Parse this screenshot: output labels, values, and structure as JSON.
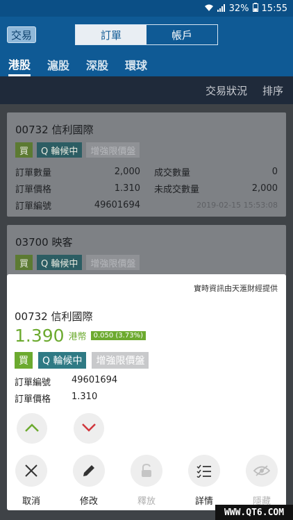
{
  "status": {
    "signal": "⋮☰",
    "battery": "32%",
    "time": "15:55"
  },
  "header": {
    "trade_label": "交易",
    "segments": [
      "訂單",
      "帳戶"
    ],
    "market_tabs": [
      "港股",
      "滬股",
      "深股",
      "環球"
    ]
  },
  "subbar": {
    "status_label": "交易狀況",
    "sort_label": "排序"
  },
  "orders": [
    {
      "title": "00732  信利國際",
      "badges": [
        "買",
        "Q 輪候中",
        "增強限價盤"
      ],
      "qty_label": "訂單數量",
      "qty": "2,000",
      "filled_label": "成交數量",
      "filled": "0",
      "price_label": "訂單價格",
      "price": "1.310",
      "unfilled_label": "未成交數量",
      "unfilled": "2,000",
      "no_label": "訂單編號",
      "no": "49601694",
      "time": "2019-02-15 15:53:08"
    },
    {
      "title": "03700  映客",
      "badges": [
        "買",
        "Q 輪候中",
        "增強限價盤"
      ]
    }
  ],
  "sheet": {
    "provider": "實時資訊由天滙財經提供",
    "title": "00732  信利國際",
    "price": "1.390",
    "currency": "港幣",
    "change": "0.050 (3.73%)",
    "badges": [
      "買",
      "Q 輪候中",
      "增強限價盤"
    ],
    "order_no_label": "訂單編號",
    "order_no": "49601694",
    "order_price_label": "訂單價格",
    "order_price": "1.310",
    "actions": [
      "取消",
      "修改",
      "釋放",
      "詳情",
      "隱藏"
    ]
  },
  "watermark": "WWW.QT6.COM",
  "colors": {
    "header": "#0f5a95",
    "up_green": "#6caa2f",
    "queue_teal": "#2f7a84",
    "down_red": "#d0363c"
  }
}
